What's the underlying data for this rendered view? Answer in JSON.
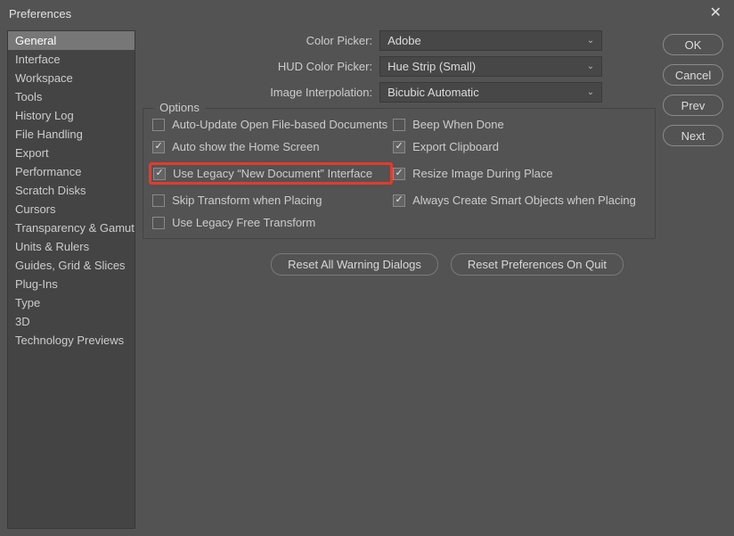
{
  "title": "Preferences",
  "sidebar": {
    "items": [
      {
        "label": "General"
      },
      {
        "label": "Interface"
      },
      {
        "label": "Workspace"
      },
      {
        "label": "Tools"
      },
      {
        "label": "History Log"
      },
      {
        "label": "File Handling"
      },
      {
        "label": "Export"
      },
      {
        "label": "Performance"
      },
      {
        "label": "Scratch Disks"
      },
      {
        "label": "Cursors"
      },
      {
        "label": "Transparency & Gamut"
      },
      {
        "label": "Units & Rulers"
      },
      {
        "label": "Guides, Grid & Slices"
      },
      {
        "label": "Plug-Ins"
      },
      {
        "label": "Type"
      },
      {
        "label": "3D"
      },
      {
        "label": "Technology Previews"
      }
    ],
    "selected_index": 0
  },
  "form": {
    "color_picker": {
      "label": "Color Picker:",
      "value": "Adobe"
    },
    "hud_color_picker": {
      "label": "HUD Color Picker:",
      "value": "Hue Strip (Small)"
    },
    "image_interpolation": {
      "label": "Image Interpolation:",
      "value": "Bicubic Automatic"
    }
  },
  "options": {
    "legend": "Options",
    "left": [
      {
        "label": "Auto-Update Open File-based Documents",
        "checked": false
      },
      {
        "label": "Auto show the Home Screen",
        "checked": true
      },
      {
        "label": "Use Legacy “New Document” Interface",
        "checked": true,
        "highlight": true
      },
      {
        "label": "Skip Transform when Placing",
        "checked": false
      },
      {
        "label": "Use Legacy Free Transform",
        "checked": false
      }
    ],
    "right": [
      {
        "label": "Beep When Done",
        "checked": false
      },
      {
        "label": "Export Clipboard",
        "checked": true
      },
      {
        "label": "Resize Image During Place",
        "checked": true
      },
      {
        "label": "Always Create Smart Objects when Placing",
        "checked": true
      }
    ]
  },
  "bottom_buttons": {
    "reset_warnings": "Reset All Warning Dialogs",
    "reset_prefs": "Reset Preferences On Quit"
  },
  "right_buttons": {
    "ok": "OK",
    "cancel": "Cancel",
    "prev": "Prev",
    "next": "Next"
  }
}
